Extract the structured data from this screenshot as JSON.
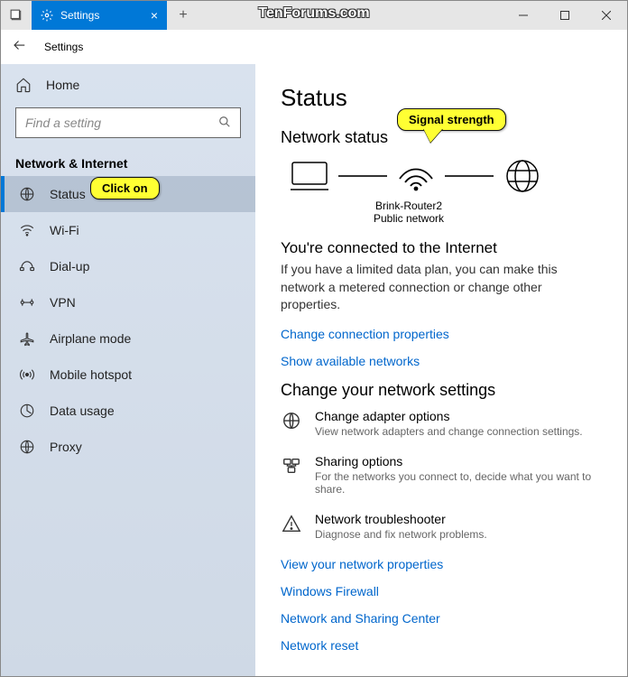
{
  "titlebar": {
    "tab_label": "Settings",
    "new_tab": "+"
  },
  "header": {
    "title": "Settings"
  },
  "watermark": "TenForums.com",
  "sidebar": {
    "home": "Home",
    "search_placeholder": "Find a setting",
    "section": "Network & Internet",
    "items": [
      {
        "label": "Status"
      },
      {
        "label": "Wi-Fi"
      },
      {
        "label": "Dial-up"
      },
      {
        "label": "VPN"
      },
      {
        "label": "Airplane mode"
      },
      {
        "label": "Mobile hotspot"
      },
      {
        "label": "Data usage"
      },
      {
        "label": "Proxy"
      }
    ]
  },
  "main": {
    "title": "Status",
    "network_status": "Network status",
    "router_name": "Brink-Router2",
    "network_type": "Public network",
    "connected_title": "You're connected to the Internet",
    "connected_body": "If you have a limited data plan, you can make this network a metered connection or change other properties.",
    "link_change_props": "Change connection properties",
    "link_show_networks": "Show available networks",
    "change_settings_title": "Change your network settings",
    "rows": [
      {
        "title": "Change adapter options",
        "desc": "View network adapters and change connection settings."
      },
      {
        "title": "Sharing options",
        "desc": "For the networks you connect to, decide what you want to share."
      },
      {
        "title": "Network troubleshooter",
        "desc": "Diagnose and fix network problems."
      }
    ],
    "links": [
      "View your network properties",
      "Windows Firewall",
      "Network and Sharing Center",
      "Network reset"
    ]
  },
  "callouts": {
    "click_on": "Click on",
    "signal": "Signal strength"
  }
}
